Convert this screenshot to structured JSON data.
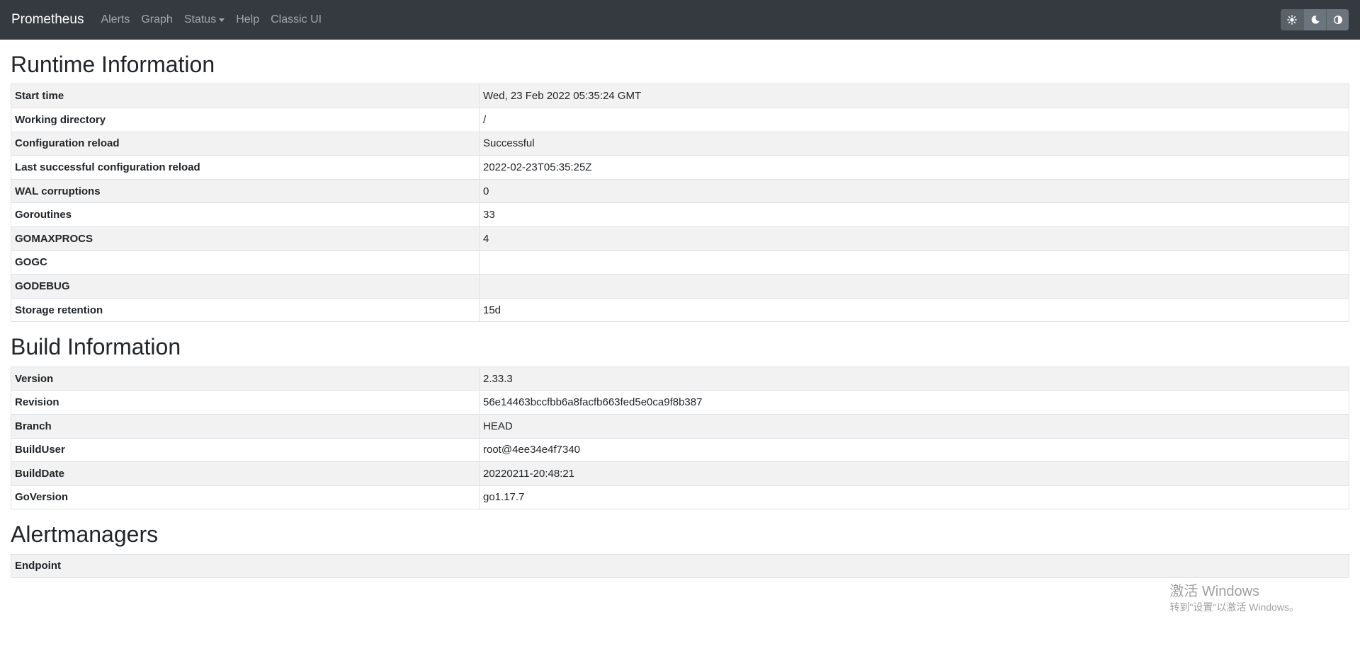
{
  "navbar": {
    "brand": "Prometheus",
    "items": [
      {
        "label": "Alerts"
      },
      {
        "label": "Graph"
      },
      {
        "label": "Status"
      },
      {
        "label": "Help"
      },
      {
        "label": "Classic UI"
      }
    ],
    "theme_buttons": [
      {
        "icon": "sun-icon"
      },
      {
        "icon": "moon-icon"
      },
      {
        "icon": "adjust-icon"
      }
    ]
  },
  "runtime": {
    "title": "Runtime Information",
    "rows": [
      {
        "key": "Start time",
        "value": "Wed, 23 Feb 2022 05:35:24 GMT"
      },
      {
        "key": "Working directory",
        "value": "/"
      },
      {
        "key": "Configuration reload",
        "value": "Successful"
      },
      {
        "key": "Last successful configuration reload",
        "value": "2022-02-23T05:35:25Z"
      },
      {
        "key": "WAL corruptions",
        "value": "0"
      },
      {
        "key": "Goroutines",
        "value": "33"
      },
      {
        "key": "GOMAXPROCS",
        "value": "4"
      },
      {
        "key": "GOGC",
        "value": ""
      },
      {
        "key": "GODEBUG",
        "value": ""
      },
      {
        "key": "Storage retention",
        "value": "15d"
      }
    ]
  },
  "build": {
    "title": "Build Information",
    "rows": [
      {
        "key": "Version",
        "value": "2.33.3"
      },
      {
        "key": "Revision",
        "value": "56e14463bccfbb6a8facfb663fed5e0ca9f8b387"
      },
      {
        "key": "Branch",
        "value": "HEAD"
      },
      {
        "key": "BuildUser",
        "value": "root@4ee34e4f7340"
      },
      {
        "key": "BuildDate",
        "value": "20220211-20:48:21"
      },
      {
        "key": "GoVersion",
        "value": "go1.17.7"
      }
    ]
  },
  "alertmanagers": {
    "title": "Alertmanagers",
    "header": "Endpoint"
  },
  "watermark": {
    "line1": "激活 Windows",
    "line2": "转到\"设置\"以激活 Windows。"
  }
}
